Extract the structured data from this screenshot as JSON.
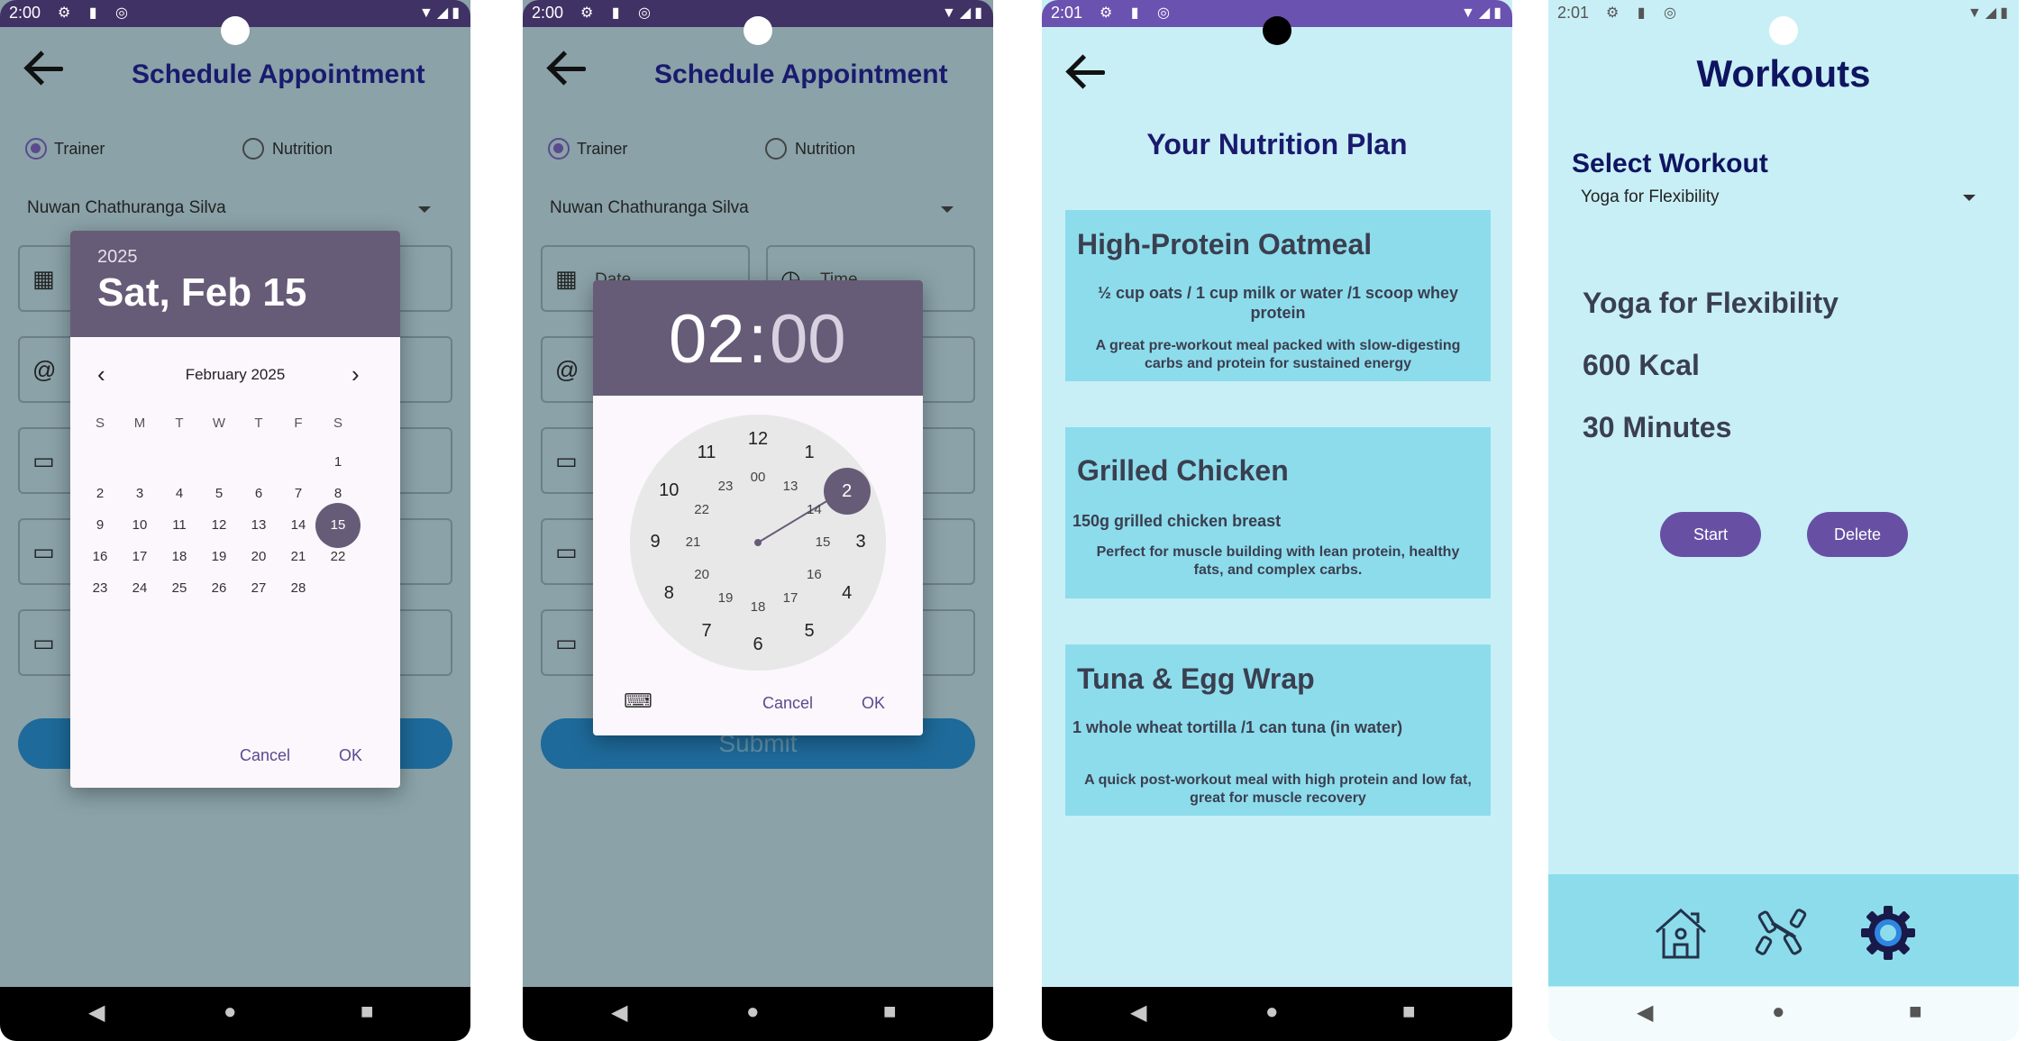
{
  "colors": {
    "overlay_bg": "#8aa2a8",
    "status_purple": "#413265",
    "nutrition_bg": "#c8eff6",
    "card_bg": "#8ddcec",
    "dialog_header": "#675c77",
    "accent": "#6750a4",
    "title_navy": "#1a1a6e"
  },
  "screen1": {
    "status": {
      "time": "2:00",
      "left_icons": "⚙ ▮ ◎",
      "right_icons": "▼◢▮"
    },
    "title": "Schedule Appointment",
    "radio_trainer": "Trainer",
    "radio_nutrition": "Nutrition",
    "selected_trainer": "Nuwan Chathuranga Silva",
    "icons": [
      "calendar-icon",
      "at-icon",
      "card-icon",
      "card-icon",
      "card-icon"
    ],
    "date_picker": {
      "year": "2025",
      "selected_date": "Sat, Feb 15",
      "month_label": "February 2025",
      "weekdays": [
        "S",
        "M",
        "T",
        "W",
        "T",
        "F",
        "S"
      ],
      "weeks": [
        [
          "",
          "",
          "",
          "",
          "",
          "",
          "1"
        ],
        [
          "2",
          "3",
          "4",
          "5",
          "6",
          "7",
          "8"
        ],
        [
          "9",
          "10",
          "11",
          "12",
          "13",
          "14",
          "15"
        ],
        [
          "16",
          "17",
          "18",
          "19",
          "20",
          "21",
          "22"
        ],
        [
          "23",
          "24",
          "25",
          "26",
          "27",
          "28",
          ""
        ]
      ],
      "selected_day": "15",
      "cancel_label": "Cancel",
      "ok_label": "OK"
    }
  },
  "screen2": {
    "status": {
      "time": "2:00",
      "left_icons": "⚙ ▮ ◎",
      "right_icons": "▼◢▮"
    },
    "title": "Schedule Appointment",
    "radio_trainer": "Trainer",
    "radio_nutrition": "Nutrition",
    "selected_trainer": "Nuwan Chathuranga Silva",
    "date_placeholder": "Date",
    "time_placeholder": "Time",
    "submit_label": "Submit",
    "time_picker": {
      "hour": "02",
      "separator": ":",
      "minute": "00",
      "outer_numbers": [
        "12",
        "1",
        "2",
        "3",
        "4",
        "5",
        "6",
        "7",
        "8",
        "9",
        "10",
        "11"
      ],
      "inner_numbers": [
        "00",
        "13",
        "14",
        "15",
        "16",
        "17",
        "18",
        "19",
        "20",
        "21",
        "22",
        "23"
      ],
      "selected": "2",
      "cancel_label": "Cancel",
      "ok_label": "OK"
    }
  },
  "screen3": {
    "status": {
      "time": "2:01",
      "left_icons": "⚙ ▮ ◎",
      "right_icons": "▼◢▮"
    },
    "title": "Your Nutrition Plan",
    "cards": [
      {
        "title": "High-Protein Oatmeal",
        "ingredients": "½ cup oats / 1 cup milk or water /1 scoop whey protein",
        "description": "A great pre-workout meal packed with slow-digesting carbs and protein for sustained energy"
      },
      {
        "title": "Grilled Chicken",
        "ingredients": "150g grilled chicken breast",
        "description": "Perfect for muscle building with lean protein, healthy fats, and complex carbs."
      },
      {
        "title": "Tuna & Egg Wrap",
        "ingredients": "1 whole wheat tortilla /1 can tuna (in water)",
        "description": "A quick post-workout meal with high protein and low fat, great for muscle recovery"
      }
    ]
  },
  "screen4": {
    "status": {
      "time": "2:01",
      "left_icons": "⚙ ▮ ◎",
      "right_icons": "▼◢▮"
    },
    "title": "Workouts",
    "select_label": "Select Workout",
    "selected_workout": "Yoga for Flexibility",
    "workout_name": "Yoga for Flexibility",
    "calories": "600 Kcal",
    "duration": "30 Minutes",
    "start_label": "Start",
    "delete_label": "Delete",
    "tabs": [
      "home-icon",
      "dumbbell-icon",
      "settings-gear-icon"
    ]
  }
}
